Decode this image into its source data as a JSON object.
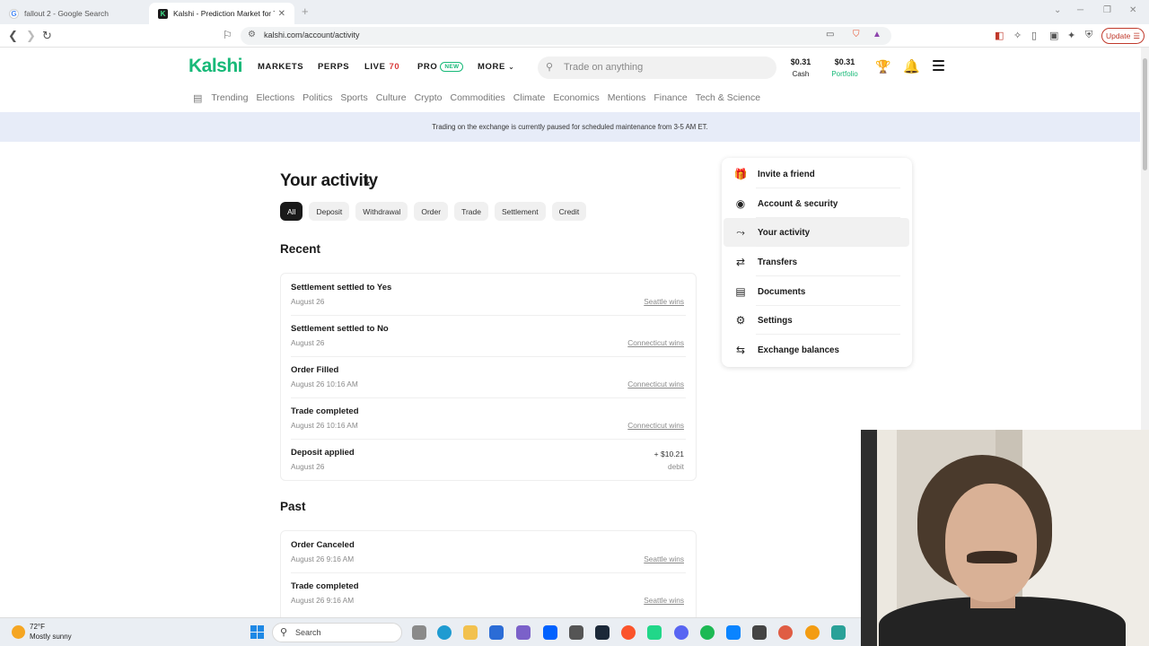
{
  "browser": {
    "tabs": [
      {
        "title": "fallout 2 - Google Search",
        "favicon": "G"
      },
      {
        "title": "Kalshi - Prediction Market for Tr",
        "favicon": "K"
      }
    ],
    "new_tab": "+",
    "url": "kalshi.com/account/activity",
    "update_label": "Update"
  },
  "header": {
    "logo": "Kalshi",
    "nav": {
      "markets": "MARKETS",
      "perps": "PERPS",
      "live": "LIVE",
      "live_count": "70",
      "pro": "PRO",
      "pro_badge": "NEW",
      "more": "MORE"
    },
    "search_placeholder": "Trade on anything",
    "cash_value": "$0.31",
    "cash_label": "Cash",
    "portfolio_value": "$0.31",
    "portfolio_label": "Portfolio"
  },
  "categories": [
    "Trending",
    "Elections",
    "Politics",
    "Sports",
    "Culture",
    "Crypto",
    "Commodities",
    "Climate",
    "Economics",
    "Mentions",
    "Finance",
    "Tech & Science"
  ],
  "banner": "Trading on the exchange is currently paused for scheduled maintenance from 3-5 AM ET.",
  "activity": {
    "title": "Your activity",
    "filters": [
      "All",
      "Deposit",
      "Withdrawal",
      "Order",
      "Trade",
      "Settlement",
      "Credit"
    ],
    "recent_title": "Recent",
    "recent": [
      {
        "title": "Settlement settled to Yes",
        "date": "August 26",
        "link": "Seattle wins"
      },
      {
        "title": "Settlement settled to No",
        "date": "August 26",
        "link": "Connecticut wins"
      },
      {
        "title": "Order Filled",
        "date": "August 26 10:16 AM",
        "link": "Connecticut wins"
      },
      {
        "title": "Trade completed",
        "date": "August 26 10:16 AM",
        "link": "Connecticut wins"
      },
      {
        "title": "Deposit applied",
        "date": "August 26",
        "amount": "+ $10.21",
        "sub": "debit"
      }
    ],
    "past_title": "Past",
    "past": [
      {
        "title": "Order Canceled",
        "date": "August 26 9:16 AM",
        "link": "Seattle wins"
      },
      {
        "title": "Trade completed",
        "date": "August 26 9:16 AM",
        "link": "Seattle wins"
      }
    ]
  },
  "menu": [
    {
      "label": "Invite a friend",
      "icon": "gift-icon",
      "glyph": "🎁"
    },
    {
      "label": "Account & security",
      "icon": "user-circle-icon",
      "glyph": "◉"
    },
    {
      "label": "Your activity",
      "icon": "activity-icon",
      "glyph": "⤳"
    },
    {
      "label": "Transfers",
      "icon": "transfer-icon",
      "glyph": "⇄"
    },
    {
      "label": "Documents",
      "icon": "document-icon",
      "glyph": "▤"
    },
    {
      "label": "Settings",
      "icon": "gear-icon",
      "glyph": "⚙"
    },
    {
      "label": "Exchange balances",
      "icon": "exchange-icon",
      "glyph": "⇆"
    }
  ],
  "menu_selected": "Your activity",
  "taskbar": {
    "temperature": "72°F",
    "weather": "Mostly sunny",
    "search_label": "Search"
  },
  "colors": {
    "brand": "#17b978",
    "live": "#d93b3b",
    "banner_bg": "#e7ecf8",
    "active_chip": "#1a1a1a"
  }
}
